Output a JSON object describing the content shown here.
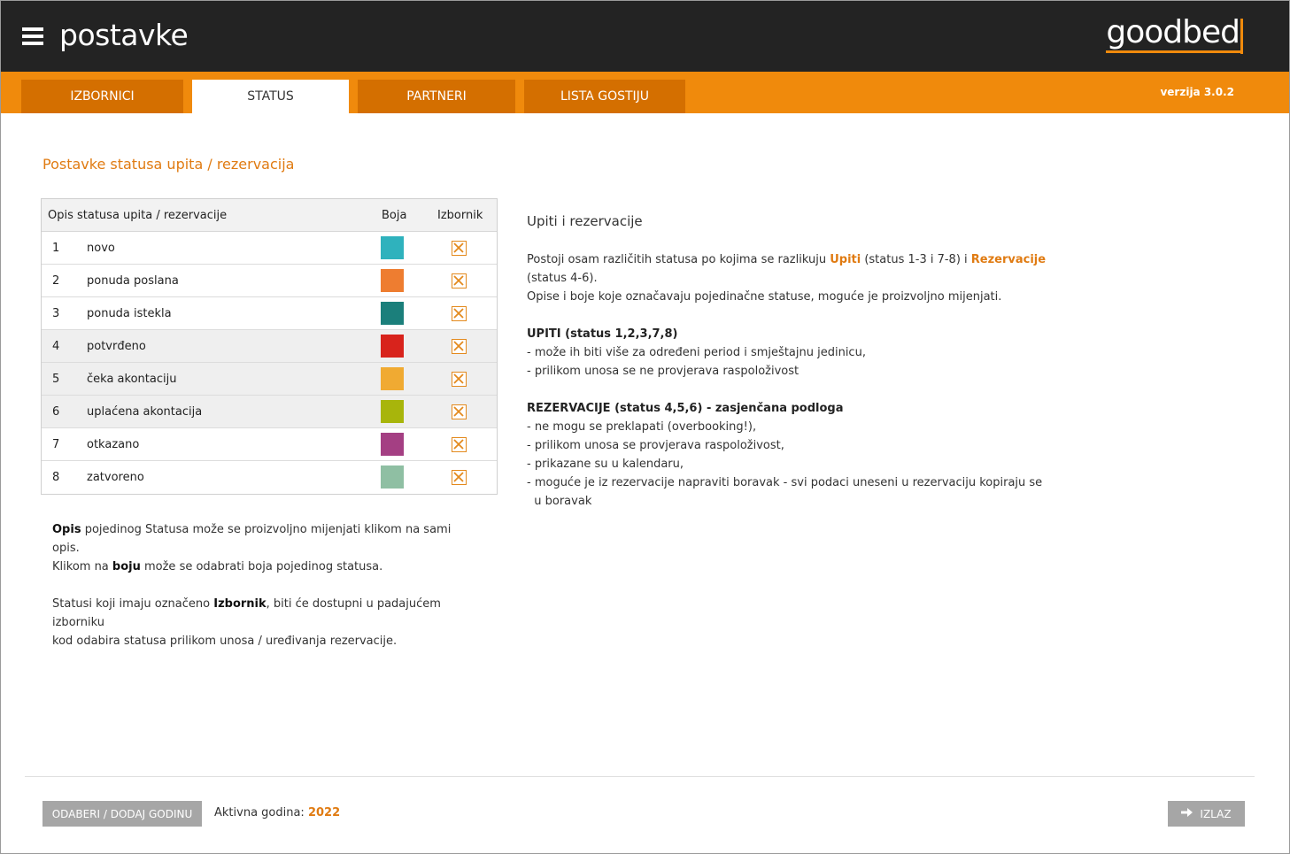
{
  "header": {
    "title": "postavke",
    "logo": "goodbed"
  },
  "tabs": [
    {
      "label": "IZBORNICI",
      "active": false
    },
    {
      "label": "STATUS",
      "active": true
    },
    {
      "label": "PARTNERI",
      "active": false
    },
    {
      "label": "LISTA GOSTIJU",
      "active": false
    }
  ],
  "version": "verzija 3.0.2",
  "page_heading": "Postavke statusa upita / rezervacija",
  "table": {
    "headers": {
      "description": "Opis statusa upita / rezervacije",
      "color": "Boja",
      "menu": "Izbornik"
    },
    "rows": [
      {
        "num": "1",
        "label": "novo",
        "color": "#2fb2bd",
        "in_menu": true,
        "shaded": false
      },
      {
        "num": "2",
        "label": "ponuda poslana",
        "color": "#ee7d30",
        "in_menu": true,
        "shaded": false
      },
      {
        "num": "3",
        "label": "ponuda istekla",
        "color": "#1b7f7b",
        "in_menu": true,
        "shaded": false
      },
      {
        "num": "4",
        "label": "potvrđeno",
        "color": "#d8231c",
        "in_menu": true,
        "shaded": true
      },
      {
        "num": "5",
        "label": "čeka akontaciju",
        "color": "#f0aa32",
        "in_menu": true,
        "shaded": true
      },
      {
        "num": "6",
        "label": "uplaćena akontacija",
        "color": "#a8b50b",
        "in_menu": true,
        "shaded": true
      },
      {
        "num": "7",
        "label": "otkazano",
        "color": "#a43f83",
        "in_menu": true,
        "shaded": false
      },
      {
        "num": "8",
        "label": "zatvoreno",
        "color": "#8fbfa3",
        "in_menu": true,
        "shaded": false
      }
    ]
  },
  "help_left": {
    "p1_bold": "Opis",
    "p1_rest": " pojedinog Statusa može se proizvoljno mijenjati klikom na sami opis.",
    "p2_pre": "Klikom na ",
    "p2_bold": "boju",
    "p2_rest": " može se odabrati boja pojedinog statusa.",
    "p3_pre": "Statusi koji imaju označeno ",
    "p3_bold": "Izbornik",
    "p3_rest": ", biti će dostupni u padajućem izborniku",
    "p4": "kod odabira statusa prilikom unosa / uređivanja rezervacije."
  },
  "info": {
    "title": "Upiti i rezervacije",
    "intro_pre": "Postoji osam različitih statusa po kojima se razlikuju ",
    "intro_upiti": "Upiti",
    "intro_mid": " (status 1-3 i 7-8) i ",
    "intro_rez": "Rezervacije",
    "intro_post": " (status 4-6).",
    "intro_line2": "Opise i boje koje označavaju pojedinačne statuse, moguće je proizvoljno mijenjati.",
    "upiti_title": "UPITI (status 1,2,3,7,8)",
    "upiti_lines": [
      "- može ih biti više za određeni period i smještajnu jedinicu,",
      "- prilikom unosa se ne provjerava raspoloživost"
    ],
    "rez_title": "REZERVACIJE (status 4,5,6) - zasjenčana podloga",
    "rez_lines": [
      "- ne mogu se preklapati (overbooking!),",
      "- prilikom unosa se provjerava raspoloživost,",
      "- prikazane su u kalendaru,",
      "- moguće je iz rezervacije napraviti boravak - svi podaci uneseni u rezervaciju kopiraju se",
      "  u boravak"
    ]
  },
  "footer": {
    "year_button": "ODABERI / DODAJ GODINU",
    "active_year_label": "Aktivna godina: ",
    "active_year": "2022",
    "exit_button": "IZLAZ"
  },
  "colors": {
    "accent": "#f08a0c",
    "tab_inactive": "#d46f00",
    "header_bg": "#232323"
  },
  "icons": {
    "menu": "hamburger-icon",
    "checkbox": "checked-x-icon",
    "exit": "arrow-right-icon"
  }
}
